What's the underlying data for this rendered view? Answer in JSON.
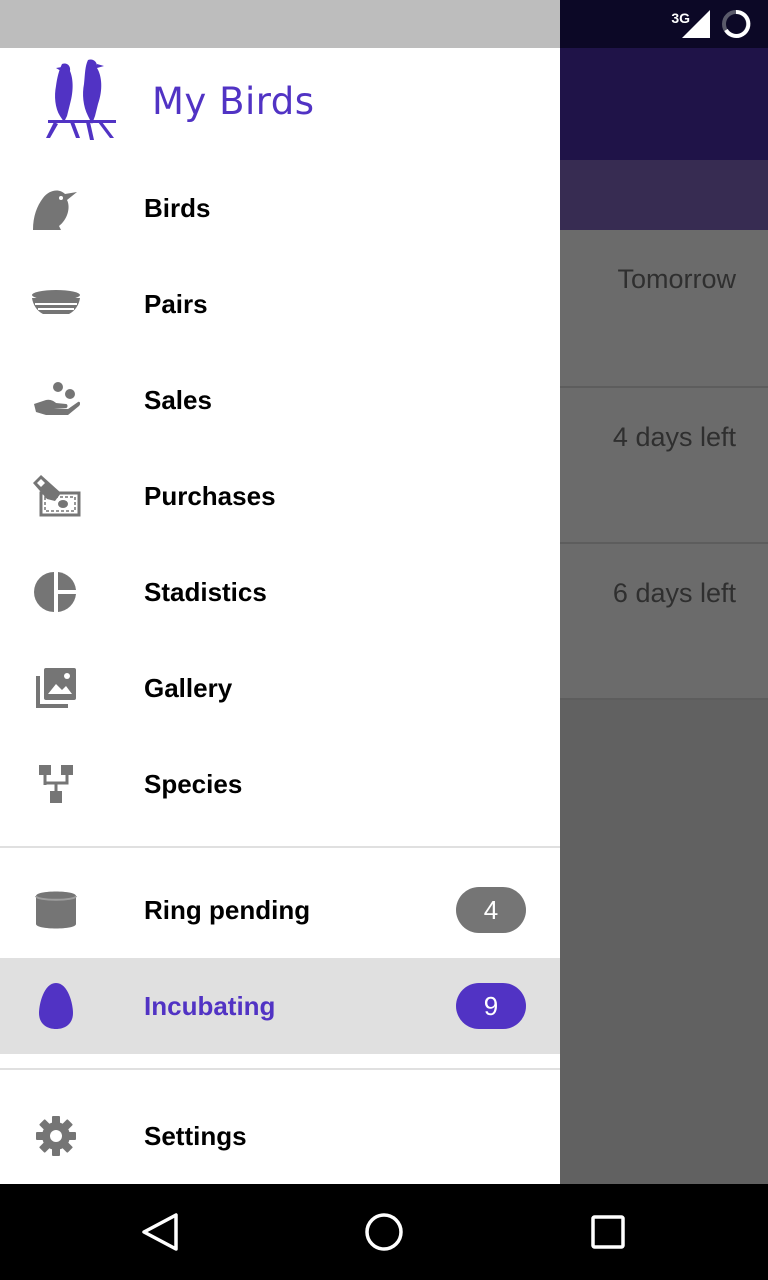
{
  "status_bar": {
    "network": "3G"
  },
  "background": {
    "rows": [
      {
        "text": "Tomorrow"
      },
      {
        "text": "4 days left"
      },
      {
        "text": "6 days left"
      }
    ]
  },
  "drawer": {
    "title": "My Birds",
    "items": [
      {
        "label": "Birds",
        "icon": "bird-icon"
      },
      {
        "label": "Pairs",
        "icon": "nest-icon"
      },
      {
        "label": "Sales",
        "icon": "hand-coins-icon"
      },
      {
        "label": "Purchases",
        "icon": "cash-payment-icon"
      },
      {
        "label": "Stadistics",
        "icon": "pie-chart-icon"
      },
      {
        "label": "Gallery",
        "icon": "gallery-icon"
      },
      {
        "label": "Species",
        "icon": "hierarchy-icon"
      }
    ],
    "secondary": [
      {
        "label": "Ring pending",
        "badge": "4",
        "icon": "ring-icon",
        "active": false
      },
      {
        "label": "Incubating",
        "badge": "9",
        "icon": "egg-icon",
        "active": true
      }
    ],
    "footer": [
      {
        "label": "Settings",
        "icon": "gear-icon"
      }
    ]
  },
  "colors": {
    "accent": "#5133c4",
    "icon": "#757575",
    "badge_inactive": "#757575",
    "badge_active": "#5133c4"
  }
}
